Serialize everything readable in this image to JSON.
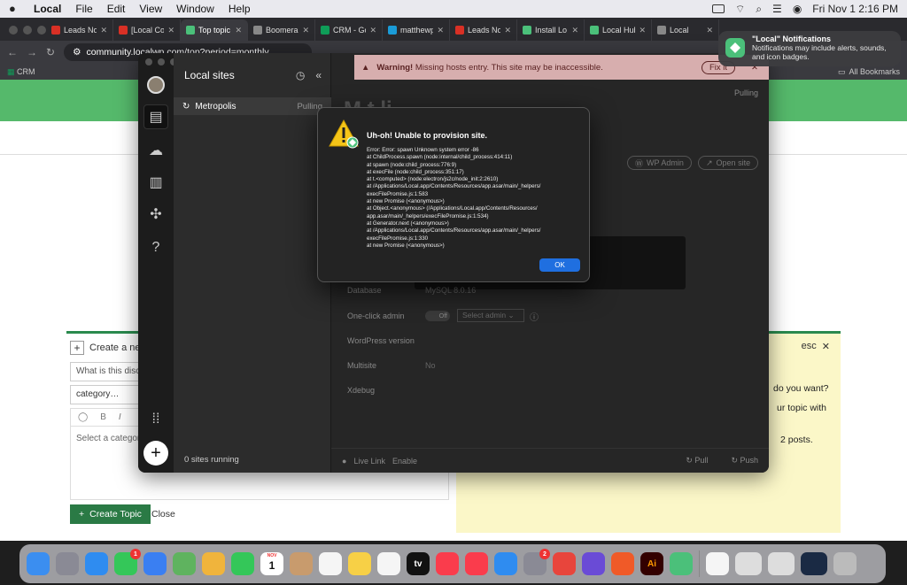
{
  "menubar": {
    "app": "Local",
    "items": [
      "File",
      "Edit",
      "View",
      "Window",
      "Help"
    ],
    "clock": "Fri Nov 1  2:16 PM"
  },
  "browser": {
    "tabs": [
      {
        "label": "Leads No",
        "color": "#d93025"
      },
      {
        "label": "[Local Co",
        "color": "#d93025"
      },
      {
        "label": "Top topic",
        "color": "#4bc07a",
        "active": true
      },
      {
        "label": "Boomerar",
        "color": "#888888"
      },
      {
        "label": "CRM - Go",
        "color": "#0f9d58"
      },
      {
        "label": "matthewp",
        "color": "#1a9bd7"
      },
      {
        "label": "Leads No",
        "color": "#d93025"
      },
      {
        "label": "Install Lo",
        "color": "#4bc07a"
      },
      {
        "label": "Local Hub",
        "color": "#4bc07a"
      },
      {
        "label": "Local",
        "color": "#888888"
      }
    ],
    "url": "community.localwp.com/top?period=monthly",
    "bookmark": "CRM",
    "all_bookmarks": "All Bookmarks"
  },
  "page": {
    "create_new": "Create a new",
    "title_placeholder": "What is this discu",
    "category": "category…",
    "editor_placeholder": "Select a categor",
    "create_topic": "Create Topic",
    "close": "Close",
    "esc": "esc",
    "rp_line1": "do you want?",
    "rp_line2": "ur topic with",
    "rp_line3": "2 posts."
  },
  "local": {
    "sites_header": "Local sites",
    "site_name": "Metropolis",
    "site_status": "Pulling",
    "sites_running": "0 sites running",
    "warning_bold": "Warning!",
    "warning_text": "Missing hosts entry. This site may be inaccessible.",
    "fix_it": "Fix it",
    "pulling_top": "Pulling",
    "site_title_partial": "M     t     li",
    "wp_admin": "WP Admin",
    "open_site": "Open site",
    "database_label": "Database",
    "database_value": "MySQL 8.0.16",
    "one_click_label": "One-click admin",
    "toggle_label": "Off",
    "select_admin": "Select admin",
    "wp_version_label": "WordPress version",
    "multisite_label": "Multisite",
    "multisite_value": "No",
    "xdebug_label": "Xdebug",
    "live_link": "Live Link",
    "enable": "Enable",
    "pull": "Pull",
    "push": "Push"
  },
  "dialog": {
    "title": "Uh-oh! Unable to provision site.",
    "lines": [
      "Error: Error: spawn Unknown system error -86",
      "at ChildProcess.spawn (node:internal/child_process:414:11)",
      "at spawn (node:child_process:776:9)",
      "at execFile (node:child_process:351:17)",
      "at t.<computed> (node:electron/js2c/node_init:2:2610)",
      "at /Applications/Local.app/Contents/Resources/app.asar/main/_helpers/",
      "execFilePromise.js:1:583",
      "at new Promise (<anonymous>)",
      "at Object.<anonymous> (/Applications/Local.app/Contents/Resources/",
      "app.asar/main/_helpers/execFilePromise.js:1:534)",
      "at Generator.next (<anonymous>)",
      "at /Applications/Local.app/Contents/Resources/app.asar/main/_helpers/",
      "execFilePromise.js:1:330",
      "at new Promise (<anonymous>)"
    ],
    "ok": "OK"
  },
  "notification": {
    "title": "\"Local\" Notifications",
    "body": "Notifications may include alerts, sounds, and icon badges."
  },
  "dock": {
    "apps": [
      {
        "name": "finder",
        "color": "#3b8ef0"
      },
      {
        "name": "launchpad",
        "color": "#8a8a95"
      },
      {
        "name": "safari",
        "color": "#2f8cf0"
      },
      {
        "name": "messages",
        "color": "#34c759",
        "badge": "1"
      },
      {
        "name": "mail",
        "color": "#3a7ff2"
      },
      {
        "name": "maps",
        "color": "#5fb35f"
      },
      {
        "name": "photos",
        "color": "#f0b43c"
      },
      {
        "name": "facetime",
        "color": "#34c759"
      },
      {
        "name": "calendar",
        "color": "#ffffff",
        "label_top": "NOV",
        "label": "1"
      },
      {
        "name": "contacts",
        "color": "#c89b6d"
      },
      {
        "name": "reminders",
        "color": "#f5f5f5"
      },
      {
        "name": "notes",
        "color": "#f7d046"
      },
      {
        "name": "freeform",
        "color": "#f5f5f5"
      },
      {
        "name": "tv",
        "color": "#111111",
        "label": "tv"
      },
      {
        "name": "music",
        "color": "#fa3c4c"
      },
      {
        "name": "news",
        "color": "#fa3c4c"
      },
      {
        "name": "app-store",
        "color": "#2f8cf0"
      },
      {
        "name": "system-settings",
        "color": "#8a8a95",
        "badge": "2"
      },
      {
        "name": "chrome",
        "color": "#e8453c"
      },
      {
        "name": "screen-recorder",
        "color": "#6a4bd6"
      },
      {
        "name": "brave",
        "color": "#f05a28"
      },
      {
        "name": "illustrator",
        "color": "#330000",
        "label": "Ai"
      },
      {
        "name": "local",
        "color": "#4bc07a"
      }
    ]
  }
}
